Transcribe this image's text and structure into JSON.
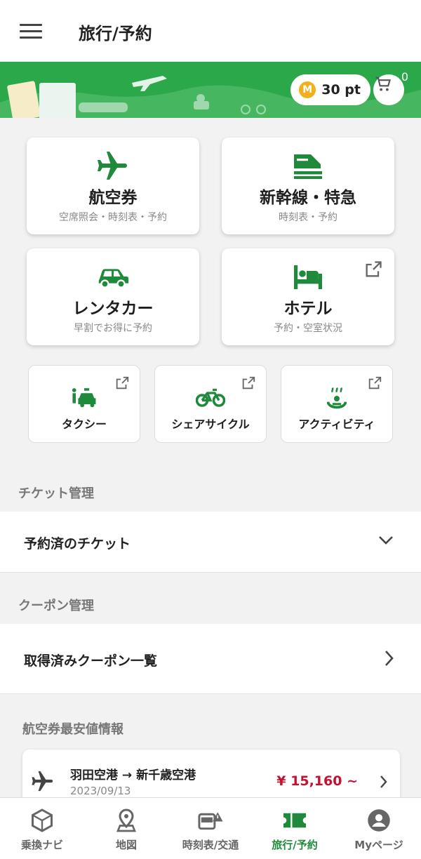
{
  "header": {
    "title": "旅行/予約",
    "menu_icon": "hamburger-menu-icon"
  },
  "banner": {
    "points_badge": "M",
    "points": "30 pt",
    "cart_count": "0",
    "colors": {
      "banner": "#2aa84a",
      "badge": "#f2b01e"
    }
  },
  "services": [
    {
      "title": "航空券",
      "subtitle": "空席照会・時刻表・予約",
      "icon": "airplane-icon"
    },
    {
      "title": "新幹線・特急",
      "subtitle": "時刻表・予約",
      "icon": "shinkansen-icon"
    },
    {
      "title": "レンタカー",
      "subtitle": "早割でお得に予約",
      "icon": "car-icon"
    },
    {
      "title": "ホテル",
      "subtitle": "予約・空室状況",
      "icon": "hotel-bed-icon",
      "external": true
    }
  ],
  "small_services": [
    {
      "title": "タクシー",
      "icon": "taxi-icon",
      "external": true
    },
    {
      "title": "シェアサイクル",
      "icon": "bicycle-icon",
      "external": true
    },
    {
      "title": "アクティビティ",
      "icon": "hot-spring-icon",
      "external": true
    }
  ],
  "ticket_section": {
    "heading": "チケット管理",
    "item": "予約済のチケット"
  },
  "coupon_section": {
    "heading": "クーポン管理",
    "item": "取得済みクーポン一覧"
  },
  "fare_section": {
    "heading": "航空券最安値情報",
    "items": [
      {
        "route": "羽田空港 → 新千歳空港",
        "date": "2023/09/13",
        "price": "¥ 15,160 ~"
      }
    ]
  },
  "tabs": [
    {
      "label": "乗換ナビ",
      "icon": "transfer-navi-icon"
    },
    {
      "label": "地図",
      "icon": "map-pin-icon"
    },
    {
      "label": "時刻表/交通",
      "icon": "bus-alert-icon"
    },
    {
      "label": "旅行/予約",
      "icon": "ticket-icon",
      "active": true
    },
    {
      "label": "Myページ",
      "icon": "person-icon"
    }
  ],
  "colors": {
    "accent_green": "#1f8a3b",
    "price_red": "#c8102e"
  }
}
